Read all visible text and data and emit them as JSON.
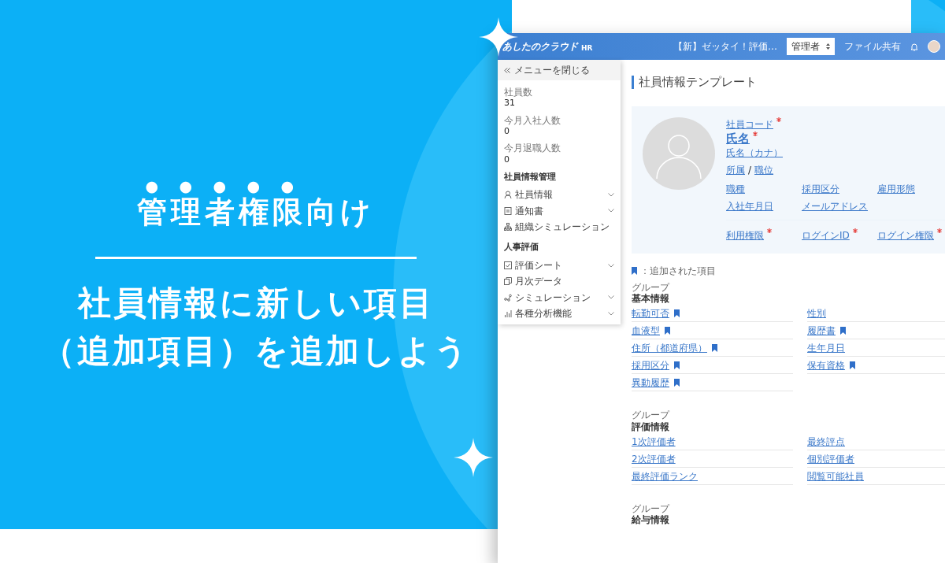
{
  "hero": {
    "heading": [
      {
        "text": "管理者権限",
        "emphasis": true
      },
      {
        "text": "向け",
        "emphasis": false
      }
    ],
    "subheading": [
      "社員情報に新しい項目",
      "（追加項目）を追加しよう"
    ]
  },
  "app": {
    "header": {
      "logo": "あしたのクラウド",
      "logo_suffix": "HR",
      "notice": "【新】ゼッタイ！評価…",
      "role_select": "管理者",
      "file_share": "ファイル共有"
    },
    "sidebar": {
      "close_menu": "メニューを閉じる",
      "stats": [
        {
          "label": "社員数",
          "value": "31"
        },
        {
          "label": "今月入社人数",
          "value": "0"
        },
        {
          "label": "今月退職人数",
          "value": "0"
        }
      ],
      "sections": [
        {
          "title": "社員情報管理",
          "items": [
            {
              "label": "社員情報",
              "expandable": true
            },
            {
              "label": "通知書",
              "expandable": true
            },
            {
              "label": "組織シミュレーション",
              "expandable": false
            }
          ]
        },
        {
          "title": "人事評価",
          "items": [
            {
              "label": "評価シート",
              "expandable": true
            },
            {
              "label": "月次データ",
              "expandable": false
            },
            {
              "label": "シミュレーション",
              "expandable": true
            },
            {
              "label": "各種分析機能",
              "expandable": true
            }
          ]
        }
      ]
    },
    "main": {
      "title": "社員情報テンプレート",
      "profile": {
        "employee_code": {
          "label": "社員コード",
          "required": true
        },
        "name": {
          "label": "氏名",
          "required": true
        },
        "name_kana": "氏名（カナ）",
        "affiliation": "所属",
        "separator": "/",
        "position": "職位",
        "fields": [
          "職種",
          "採用区分",
          "雇用形態",
          "入社年月日",
          "メールアドレス"
        ],
        "login_fields": [
          {
            "label": "利用権限",
            "required": true
          },
          {
            "label": "ログインID",
            "required": true
          },
          {
            "label": "ログイン権限",
            "required": true
          }
        ]
      },
      "legend": "：追加された項目",
      "groups": [
        {
          "caption": "グループ",
          "title": "基本情報",
          "fields": [
            {
              "label": "転勤可否",
              "added": true
            },
            {
              "label": "性別",
              "added": false
            },
            {
              "label": "血液型",
              "added": true
            },
            {
              "label": "履歴書",
              "added": true
            },
            {
              "label": "住所（都道府県）",
              "added": true
            },
            {
              "label": "生年月日",
              "added": false
            },
            {
              "label": "採用区分",
              "added": true
            },
            {
              "label": "保有資格",
              "added": true
            },
            {
              "label": "異動履歴",
              "added": true
            }
          ]
        },
        {
          "caption": "グループ",
          "title": "評価情報",
          "fields": [
            {
              "label": "1次評価者",
              "added": false
            },
            {
              "label": "最終評点",
              "added": false
            },
            {
              "label": "2次評価者",
              "added": false
            },
            {
              "label": "個別評価者",
              "added": false
            },
            {
              "label": "最終評価ランク",
              "added": false
            },
            {
              "label": "閲覧可能社員",
              "added": false
            }
          ]
        },
        {
          "caption": "グループ",
          "title": "給与情報"
        }
      ]
    }
  }
}
